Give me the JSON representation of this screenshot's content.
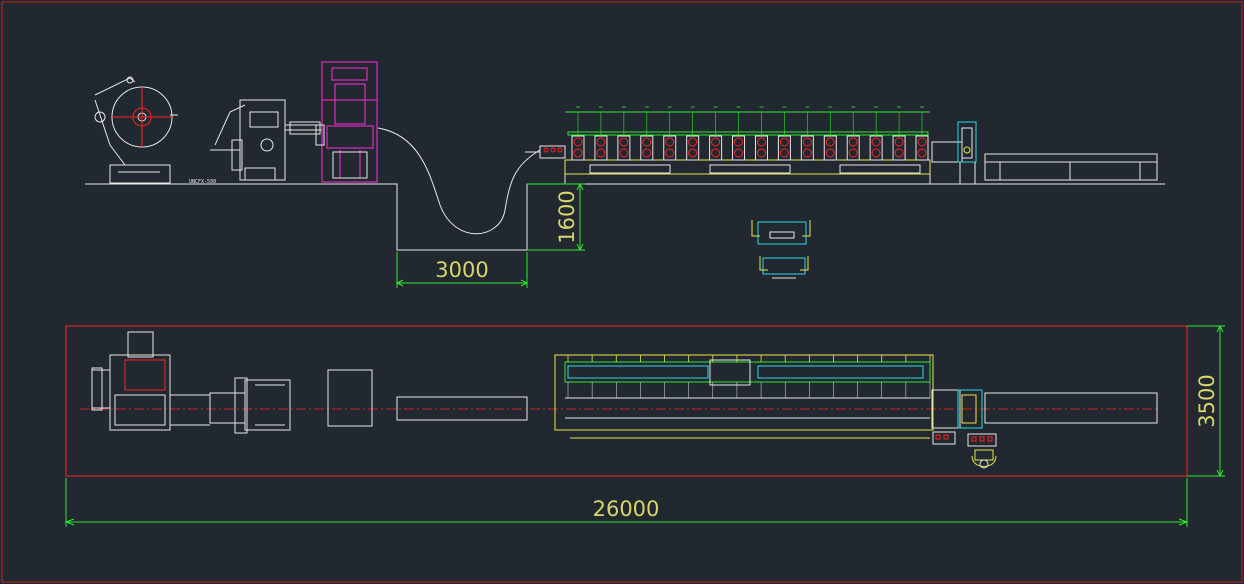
{
  "drawing": {
    "background": "#212830",
    "frame_color": "#c81e1e",
    "dimension_color": "#2ee82e",
    "dimension_text_color": "#d6d66a"
  },
  "machine_label": "UNCFX-500",
  "dimensions": {
    "pit_width": "3000",
    "pit_depth": "1600",
    "plan_width": "3500",
    "total_length": "26000"
  },
  "stations": {
    "count": 16
  }
}
